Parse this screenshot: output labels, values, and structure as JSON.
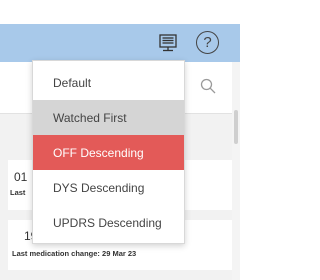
{
  "header": {
    "monitor_icon": "monitor-icon",
    "help_icon": "help-icon",
    "help_glyph": "?",
    "background": "#a8c9ea"
  },
  "search": {
    "icon": "search-icon"
  },
  "sort_menu": {
    "options": [
      {
        "label": "Default",
        "state": "normal"
      },
      {
        "label": "Watched First",
        "state": "hover"
      },
      {
        "label": "OFF Descending",
        "state": "selected"
      },
      {
        "label": "DYS Descending",
        "state": "normal"
      },
      {
        "label": "UPDRS Descending",
        "state": "normal"
      }
    ],
    "selected_color": "#e35a58",
    "hover_color": "#d5d5d5"
  },
  "cards": [
    {
      "number": "01",
      "meta": "Last"
    },
    {
      "number": "19",
      "meta": "Last medication change: 29 Mar 23"
    }
  ]
}
